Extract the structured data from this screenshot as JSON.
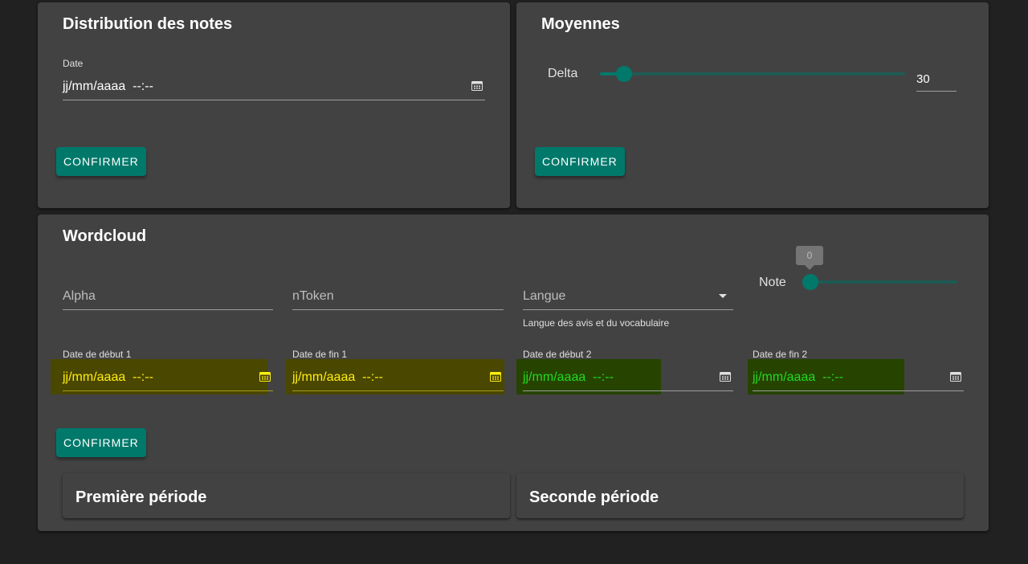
{
  "distribution": {
    "title": "Distribution des notes",
    "date_label": "Date",
    "date_value": "jj/mm/aaaa  --:--",
    "confirm_label": "CONFIRMER"
  },
  "moyennes": {
    "title": "Moyennes",
    "delta_label": "Delta",
    "delta_value": "30",
    "confirm_label": "CONFIRMER"
  },
  "wordcloud": {
    "title": "Wordcloud",
    "alpha_placeholder": "Alpha",
    "ntoken_placeholder": "nToken",
    "langue_placeholder": "Langue",
    "langue_helper": "Langue des avis et du vocabulaire",
    "note_label": "Note",
    "note_value": "0",
    "date_debut_1_label": "Date de début 1",
    "date_fin_1_label": "Date de fin 1",
    "date_debut_2_label": "Date de début 2",
    "date_fin_2_label": "Date de fin 2",
    "date_value": "jj/mm/aaaa  --:--",
    "confirm_label": "CONFIRMER",
    "premiere_periode": "Première période",
    "seconde_periode": "Seconde période"
  },
  "colors": {
    "background": "#212121",
    "card": "#424242",
    "accent": "#00796b",
    "period1_highlight": "#ffee10",
    "period2_highlight": "#22d822"
  },
  "icons": {
    "calendar": "calendar-icon",
    "dropdown": "chevron-down-icon"
  }
}
